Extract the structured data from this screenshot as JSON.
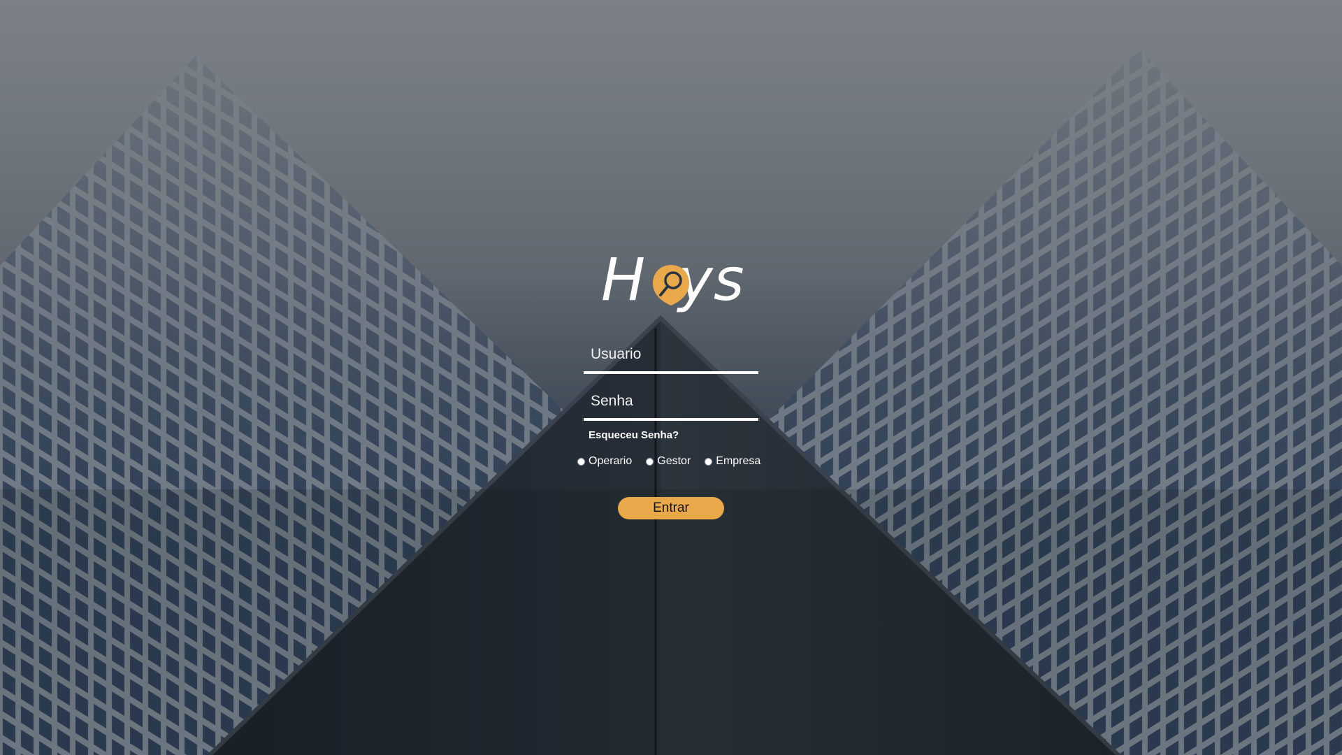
{
  "brand": {
    "name": "Hoys",
    "accent_color": "#e9a84a",
    "logo_icon": "magnifier-icon"
  },
  "login": {
    "username": {
      "value": "",
      "placeholder": "Usuario"
    },
    "password": {
      "value": "",
      "placeholder": "Senha"
    },
    "forgot_label": "Esqueceu Senha?",
    "roles": [
      {
        "label": "Operario",
        "selected": false
      },
      {
        "label": "Gestor",
        "selected": false
      },
      {
        "label": "Empresa",
        "selected": false
      }
    ],
    "submit_label": "Entrar"
  },
  "background": {
    "description_colors": {
      "sky": "#7b8086",
      "building": "#1e2630"
    }
  }
}
